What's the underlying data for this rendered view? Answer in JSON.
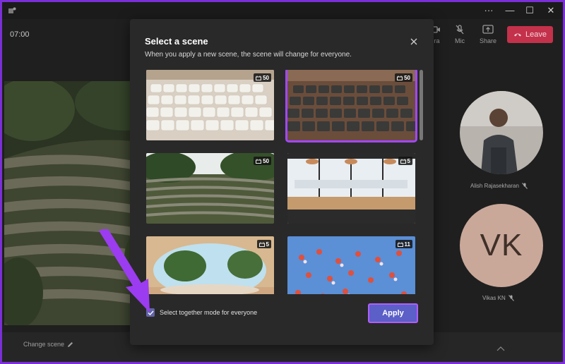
{
  "meeting": {
    "timer": "07:00",
    "controls": [
      {
        "label": "era",
        "icon": "camera-icon"
      },
      {
        "label": "Mic",
        "icon": "mic-off-icon"
      },
      {
        "label": "Share",
        "icon": "share-icon"
      }
    ],
    "leave_label": "Leave",
    "change_scene_label": "Change scene"
  },
  "window": {
    "controls": [
      "···",
      "—",
      "☐",
      "✕"
    ]
  },
  "participants": [
    {
      "name": "Alish Rajasekharan",
      "initials": ""
    },
    {
      "name": "Vikas KN",
      "initials": "VK"
    }
  ],
  "dialog": {
    "title": "Select a scene",
    "subtitle": "When you apply a new scene, the scene will change for everyone.",
    "scenes": [
      {
        "name": "white-auditorium",
        "capacity": "50",
        "selected": false
      },
      {
        "name": "dark-theater",
        "capacity": "50",
        "selected": true
      },
      {
        "name": "amphitheater",
        "capacity": "50",
        "selected": false
      },
      {
        "name": "conference-room",
        "capacity": "5",
        "selected": false
      },
      {
        "name": "oval-lounge",
        "capacity": "5",
        "selected": false
      },
      {
        "name": "floating-flowers",
        "capacity": "11",
        "selected": false
      }
    ],
    "checkbox_label": "Select together mode for everyone",
    "checkbox_checked": true,
    "apply_label": "Apply"
  },
  "colors": {
    "accent": "#a347ff",
    "apply": "#5b5fc7",
    "leave": "#c4314b",
    "dialog_bg": "#292929"
  }
}
